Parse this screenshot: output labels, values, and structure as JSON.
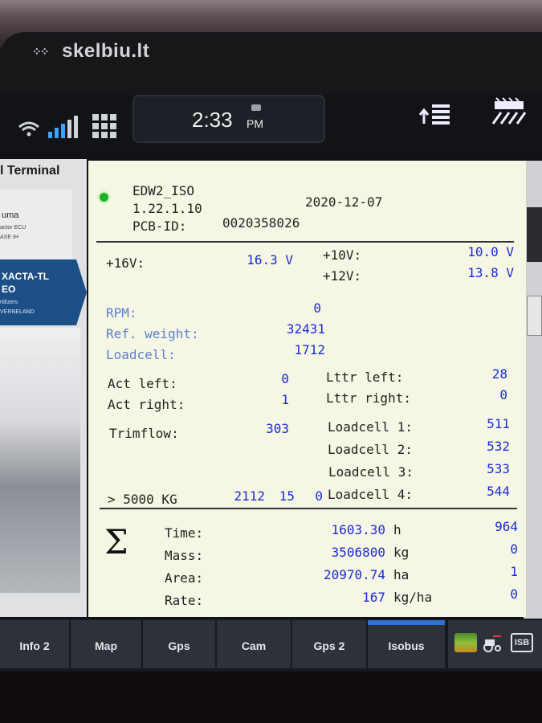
{
  "watermark": "skelbiu.lt",
  "statusbar": {
    "time": "2:33",
    "ampm": "PM"
  },
  "left_panel": {
    "title": "l Terminal",
    "item1": {
      "name": "uma",
      "sub1": "actor ECU",
      "sub2": "ASE IH"
    },
    "item2": {
      "name": "XACTA-TL",
      "name2": "EO",
      "sub1": "rtilizers",
      "sub2": "VERNELAND"
    }
  },
  "terminal": {
    "device": "EDW2_ISO",
    "version": "1.22.1.10",
    "date": "2020-12-07",
    "pcb_label": "PCB-ID:",
    "pcb_id": "0020358026",
    "volt_16_label": "+16V:",
    "volt_16_value": "16.3 V",
    "volt_10_label": "+10V:",
    "volt_10_value": "10.0 V",
    "volt_12_label": "+12V:",
    "volt_12_value": "13.8 V",
    "rpm_label": "RPM:",
    "rpm_value": "0",
    "ref_weight_label": "Ref. weight:",
    "ref_weight_value": "32431",
    "loadcell_label": "Loadcell:",
    "loadcell_value": "1712",
    "act_left_label": "Act left:",
    "act_left_value": "0",
    "act_right_label": "Act right:",
    "act_right_value": "1",
    "lttr_left_label": "Lttr left:",
    "lttr_left_value": "28",
    "lttr_right_label": "Lttr right:",
    "lttr_right_value": "0",
    "trimflow_label": "Trimflow:",
    "trimflow_value": "303",
    "lc1_label": "Loadcell 1:",
    "lc1_value": "511",
    "lc2_label": "Loadcell 2:",
    "lc2_value": "532",
    "lc3_label": "Loadcell 3:",
    "lc3_value": "533",
    "lc4_label": "Loadcell 4:",
    "lc4_value": "544",
    "over_label": "> 5000 KG",
    "over_v1": "2112",
    "over_v2": "15",
    "over_v3": "0",
    "totals": {
      "sigma": "Σ",
      "time_label": "Time:",
      "time_value": "1603.30",
      "time_unit": "h",
      "time_extra": "964",
      "mass_label": "Mass:",
      "mass_value": "3506800",
      "mass_unit": "kg",
      "mass_extra": "0",
      "area_label": "Area:",
      "area_value": "20970.74",
      "area_unit": "ha",
      "area_extra": "1",
      "rate_label": "Rate:",
      "rate_value": "167",
      "rate_unit": "kg/ha",
      "rate_extra": "0"
    }
  },
  "tabs": [
    {
      "label": "Info 2"
    },
    {
      "label": "Map"
    },
    {
      "label": "Gps"
    },
    {
      "label": "Cam"
    },
    {
      "label": "Gps 2"
    },
    {
      "label": "Isobus"
    }
  ],
  "tray_icons": [
    "field-map-icon",
    "tractor-status-icon",
    "isobus-icon"
  ],
  "tray_isobus_text": "ISB",
  "colors": {
    "value_blue": "#1b2bd6",
    "label_blue": "#5a7fcc",
    "panel_bg": "#f6f6e4",
    "tab_active": "#2e73d1",
    "status_led": "#1fae2a"
  }
}
